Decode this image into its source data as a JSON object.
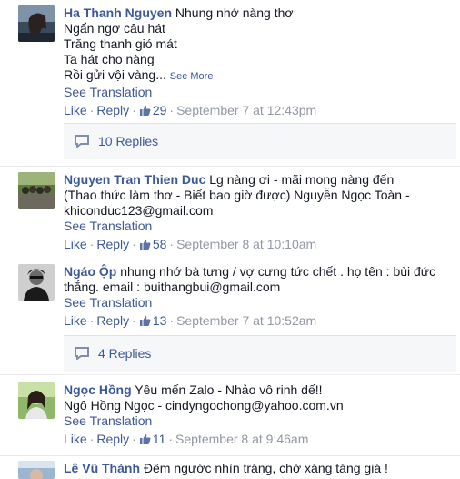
{
  "comments": [
    {
      "name": "Ha Thanh Nguyen",
      "text_first": "Nhung nhớ nàng thơ",
      "text_rest": "Ngẩn ngơ câu hát\nTrăng thanh gió mát\nTa hát cho nàng\nRồi gửi vội vàng...",
      "see_more": "See More",
      "see_translation": "See Translation",
      "like": "Like",
      "reply": "Reply",
      "likes": "29",
      "date": "September 7 at 12:43pm",
      "replies": "10 Replies"
    },
    {
      "name": "Nguyen Tran Thien Duc",
      "text_first": "Lg nàng ơi - mãi mong nàng đến",
      "text_rest": "(Thao thức làm thơ - Biết bao giờ được) Nguyễn Ngọc Toàn - khiconduc123@gmail.com",
      "see_translation": "See Translation",
      "like": "Like",
      "reply": "Reply",
      "likes": "58",
      "date": "September 8 at 10:10am"
    },
    {
      "name": "Ngáo Ộp",
      "text_first": "nhung nhớ bà tưng / vợ cưng tức chết . họ tên : bùi đức",
      "text_rest": "thắng. email : buithangbui@gmail.com",
      "see_translation": "See Translation",
      "like": "Like",
      "reply": "Reply",
      "likes": "13",
      "date": "September 7 at 10:52am",
      "replies": "4 Replies"
    },
    {
      "name": "Ngọc Hồng",
      "text_first": "Yêu mến Zalo - Nhảo vô rinh dế!!",
      "text_rest": "Ngô Hồng Ngọc - cindyngochong@yahoo.com.vn",
      "see_translation": "See Translation",
      "like": "Like",
      "reply": "Reply",
      "likes": "11",
      "date": "September 8 at 9:46am"
    },
    {
      "name": "Lê Vũ Thành",
      "text_first": "Đêm ngước nhìn trăng, chờ xăng tăng giá !"
    }
  ],
  "colors": {
    "link": "#3b5998",
    "meta": "#9197a3",
    "text": "#141823",
    "replies_bg": "#f6f7f9"
  },
  "icons": {
    "thumb": "thumbs-up-icon",
    "reply_bubble": "comment-bubble-icon"
  }
}
